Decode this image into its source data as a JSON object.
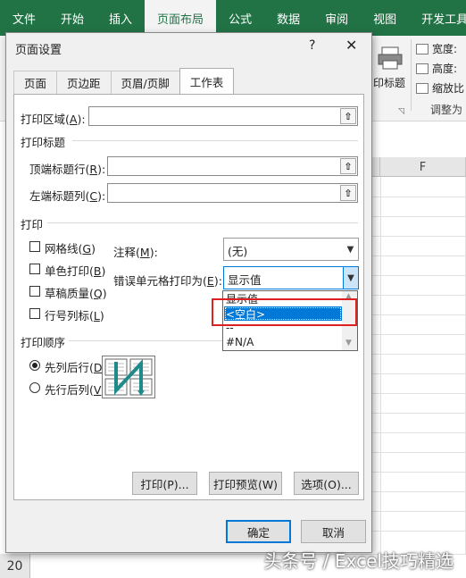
{
  "ribbon": {
    "tabs": [
      "文件",
      "开始",
      "插入",
      "页面布局",
      "公式",
      "数据",
      "审阅",
      "视图",
      "开发工具"
    ],
    "active_tab": "页面布局",
    "print_titles_label": "印标题",
    "width_label": "宽度:",
    "height_label": "高度:",
    "scale_label": "缩放比",
    "group_label": "调整为",
    "accent": "#217346"
  },
  "sheet": {
    "column_header": "F",
    "row_number": "20",
    "watermark": "头条号 / Excel技巧精选"
  },
  "dialog": {
    "title": "页面设置",
    "help": "?",
    "close": "✕",
    "tabs": [
      "页面",
      "页边距",
      "页眉/页脚",
      "工作表"
    ],
    "active_tab": "工作表",
    "print_area": {
      "label": "打印区域",
      "key": "A",
      "value": ""
    },
    "print_titles_section": "打印标题",
    "rows_to_repeat": {
      "label": "顶端标题行",
      "key": "R",
      "value": ""
    },
    "cols_to_repeat": {
      "label": "左端标题列",
      "key": "C",
      "value": ""
    },
    "print_section": "打印",
    "checkboxes": [
      {
        "label": "网格线",
        "key": "G",
        "checked": false
      },
      {
        "label": "单色打印",
        "key": "B",
        "checked": false
      },
      {
        "label": "草稿质量",
        "key": "Q",
        "checked": false
      },
      {
        "label": "行号列标",
        "key": "L",
        "checked": false
      }
    ],
    "comments": {
      "label": "注释",
      "key": "M",
      "value": "(无)"
    },
    "cell_errors": {
      "label": "错误单元格打印为",
      "key": "E",
      "value": "显示值"
    },
    "cell_errors_options": [
      "显示值",
      "<空白>",
      "--",
      "#N/A"
    ],
    "cell_errors_highlighted": "<空白>",
    "page_order_section": "打印顺序",
    "page_order": [
      {
        "label": "先列后行",
        "key": "D",
        "selected": true
      },
      {
        "label": "先行后列",
        "key": "V",
        "selected": false
      }
    ],
    "buttons": {
      "print": "打印(P)...",
      "preview": "打印预览(W)",
      "options": "选项(O)...",
      "ok": "确定",
      "cancel": "取消"
    }
  }
}
